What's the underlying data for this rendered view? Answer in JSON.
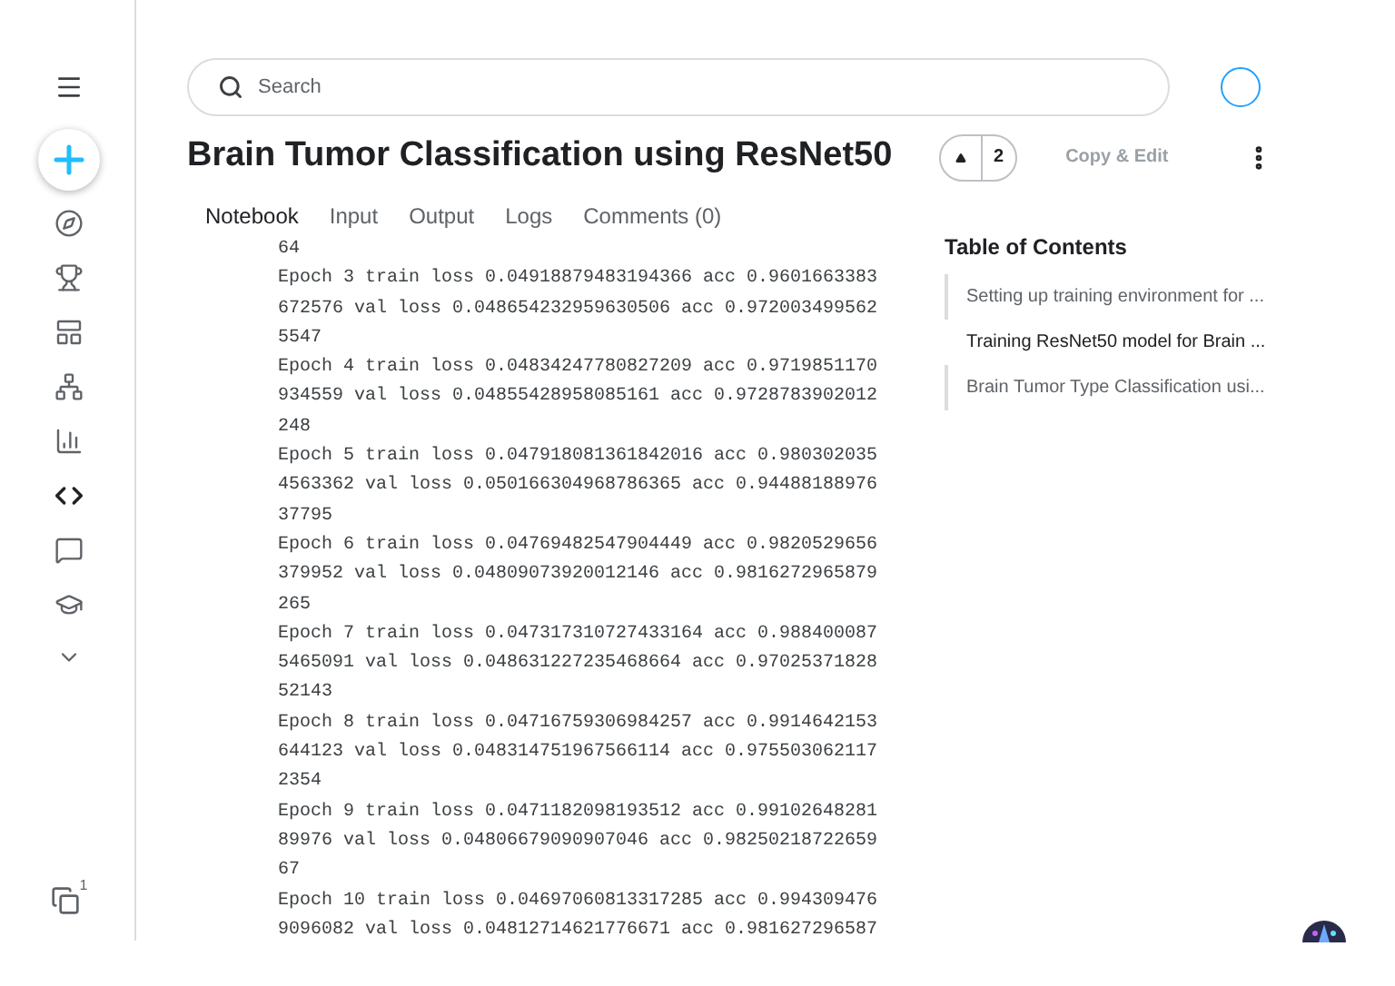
{
  "sidebar": {
    "items": [
      {
        "selected": false
      },
      {
        "selected": false
      },
      {
        "selected": false
      },
      {
        "selected": false
      },
      {
        "selected": false
      },
      {
        "selected": true
      },
      {
        "selected": false
      },
      {
        "selected": false
      }
    ],
    "copies_badge": "1"
  },
  "search": {
    "placeholder": "Search"
  },
  "title": "Brain Tumor Classification using ResNet50",
  "upvotes": "2",
  "copy_edit": "Copy & Edit",
  "tabs": [
    {
      "label": "Notebook",
      "selected": true
    },
    {
      "label": "Input",
      "selected": false
    },
    {
      "label": "Output",
      "selected": false
    },
    {
      "label": "Logs",
      "selected": false
    },
    {
      "label": "Comments (0)",
      "selected": false
    }
  ],
  "output_lines": [
    "64",
    "Epoch 3 train loss 0.04918879483194366 acc 0.9601663383",
    "672576 val loss 0.048654232959630506 acc 0.972003499562",
    "5547",
    "Epoch 4 train loss 0.04834247780827209 acc 0.9719851170",
    "934559 val loss 0.04855428958085161 acc 0.9728783902012",
    "248",
    "Epoch 5 train loss 0.047918081361842016 acc 0.980302035",
    "4563362 val loss 0.050166304968786365 acc 0.94488188976",
    "37795",
    "Epoch 6 train loss 0.04769482547904449 acc 0.9820529656",
    "379952 val loss 0.04809073920012146 acc 0.9816272965879",
    "265",
    "Epoch 7 train loss 0.047317310727433164 acc 0.988400087",
    "5465091 val loss 0.048631227235468664 acc 0.97025371828",
    "52143",
    "Epoch 8 train loss 0.04716759306984257 acc 0.9914642153",
    "644123 val loss 0.048314751967566114 acc 0.975503062117",
    "2354",
    "Epoch 9 train loss 0.0471182098193512 acc 0.99102648281",
    "89976 val loss 0.04806679090907046 acc 0.98250218722659",
    "67",
    "Epoch 10 train loss 0.04697060813317285 acc 0.994309476",
    "9096082 val loss 0.04812714621776671 acc 0.981627296587"
  ],
  "toc": {
    "title": "Table of Contents",
    "items": [
      {
        "label": "Setting up training environment for ...",
        "selected": false
      },
      {
        "label": "Training ResNet50 model for Brain ...",
        "selected": true
      },
      {
        "label": "Brain Tumor Type Classification usi...",
        "selected": false
      }
    ]
  }
}
